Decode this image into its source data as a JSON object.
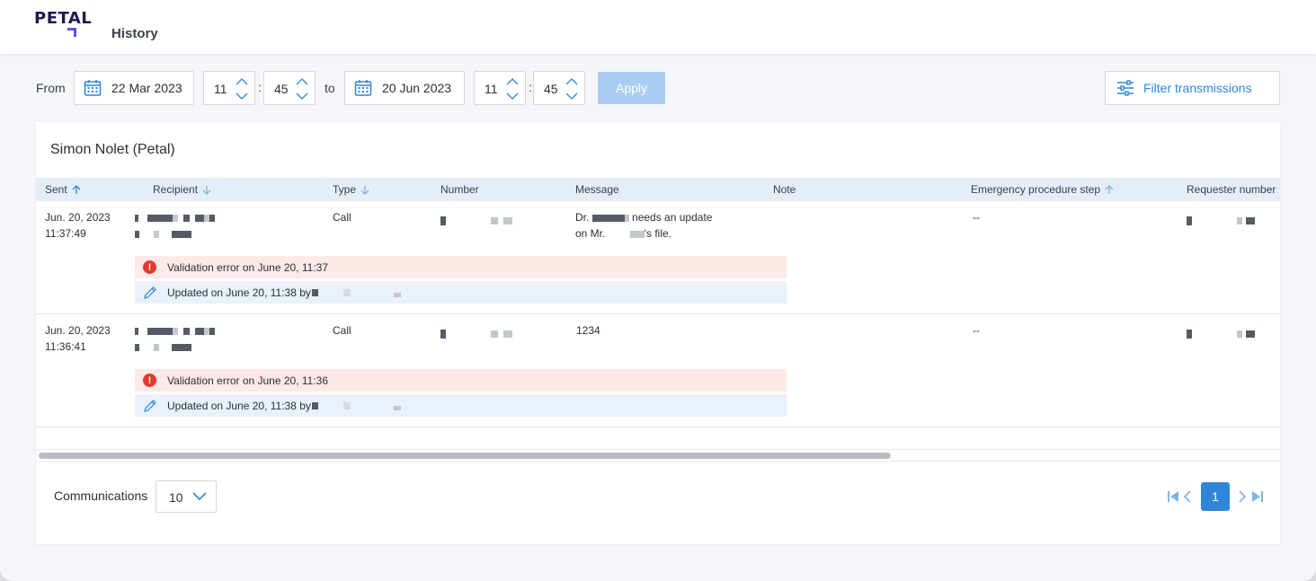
{
  "app": {
    "logo": "PETAL",
    "page_title": "History"
  },
  "filters": {
    "from_label": "From",
    "from_date": "22 Mar 2023",
    "from_hour": "11",
    "from_minute": "45",
    "to_label": "to",
    "to_date": "20 Jun 2023",
    "to_hour": "11",
    "to_minute": "45",
    "time_separator": ":",
    "apply_label": "Apply",
    "filter_transmissions_label": "Filter transmissions"
  },
  "card": {
    "title": "Simon Nolet (Petal)"
  },
  "table": {
    "columns": {
      "sent": "Sent",
      "recipient": "Recipient",
      "type": "Type",
      "number": "Number",
      "message": "Message",
      "note": "Note",
      "emergency_step": "Emergency procedure step",
      "requester_number": "Requester number"
    },
    "rows": [
      {
        "sent_date": "Jun. 20, 2023",
        "sent_time": "11:37:49",
        "type": "Call",
        "message_line1_prefix": "Dr.",
        "message_line1_suffix": "needs an update",
        "message_line2_prefix": "on Mr.",
        "message_line2_suffix": "'s file.",
        "emergency_step": "--",
        "error_text": "Validation error on June 20, 11:37",
        "update_text": "Updated on June 20, 11:38 by"
      },
      {
        "sent_date": "Jun. 20, 2023",
        "sent_time": "11:36:41",
        "type": "Call",
        "message": "1234",
        "emergency_step": "--",
        "error_text": "Validation error on June 20, 11:36",
        "update_text": "Updated on June 20, 11:38 by"
      }
    ]
  },
  "footer": {
    "page_size_label": "Communications",
    "page_size": "10",
    "current_page": "1"
  },
  "icons": {
    "calendar": "calendar-icon",
    "filter": "sliders-icon",
    "error": "error-icon",
    "edit": "pencil-icon",
    "sort_up": "arrow-up-icon",
    "sort_down": "arrow-down-icon"
  },
  "colors": {
    "accent": "#2f86d6",
    "apply_disabled": "#a9cdf2",
    "error": "#e5372b",
    "header_bg": "#e3eef9"
  }
}
